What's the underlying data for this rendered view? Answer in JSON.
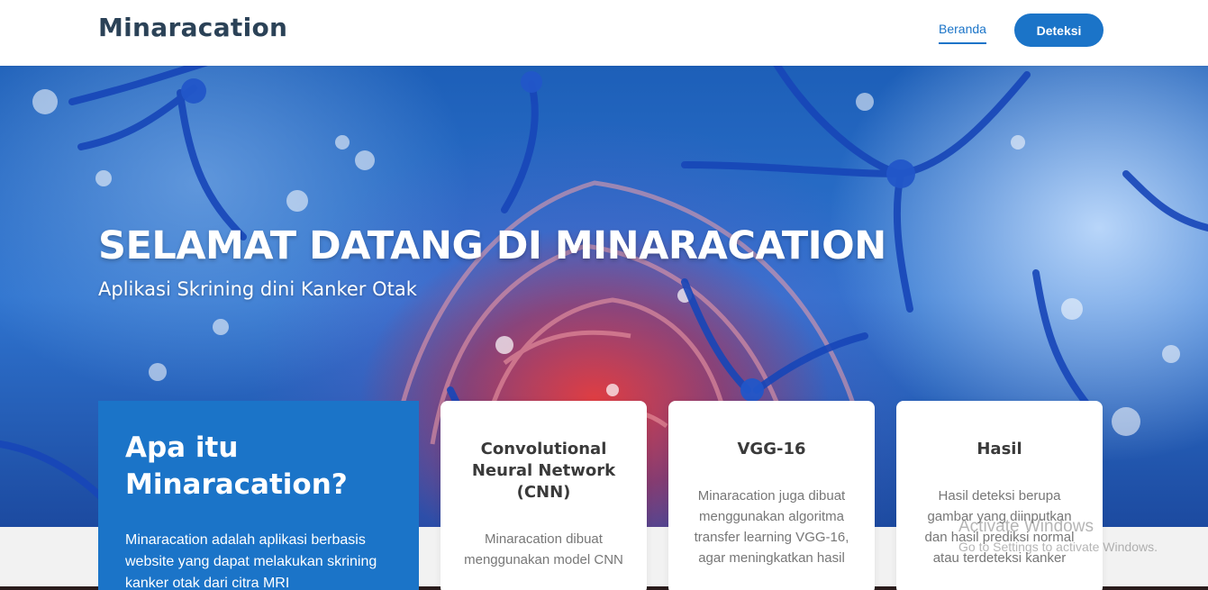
{
  "header": {
    "brand": "Minaracation",
    "nav_home": "Beranda",
    "nav_detect": "Deteksi"
  },
  "hero": {
    "title": "SELAMAT DATANG DI MINARACATION",
    "subtitle": "Aplikasi Skrining dini Kanker Otak"
  },
  "about": {
    "title": "Apa itu Minaracation?",
    "text": "Minaracation adalah aplikasi berbasis website yang dapat melakukan skrining kanker otak dari citra MRI"
  },
  "cards": [
    {
      "title": "Convolutional Neural Network (CNN)",
      "text": "Minaracation dibuat menggunakan model CNN"
    },
    {
      "title": "VGG-16",
      "text": "Minaracation juga dibuat menggunakan algoritma transfer learning VGG-16, agar meningkatkan hasil"
    },
    {
      "title": "Hasil",
      "text": "Hasil deteksi berupa gambar yang diinputkan dan hasil prediksi normal atau terdeteksi kanker"
    }
  ],
  "watermark": {
    "title": "Activate Windows",
    "subtitle": "Go to Settings to activate Windows."
  },
  "colors": {
    "brand_blue": "#1b74c8",
    "logo_dark": "#2b4257"
  }
}
